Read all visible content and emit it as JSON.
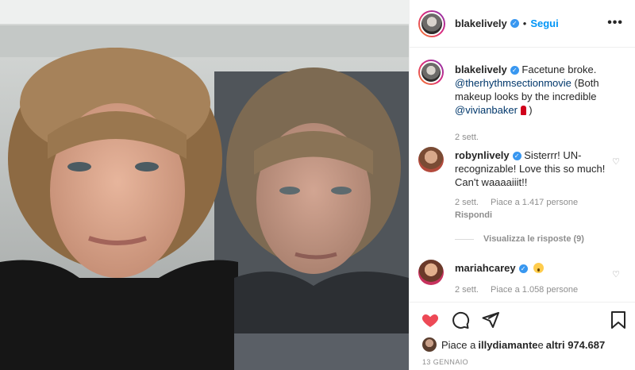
{
  "post": {
    "username": "blakelively",
    "follow_label": "Segui",
    "separator": "•",
    "more_label": "•••"
  },
  "caption": {
    "username": "blakelively",
    "text_1": "Facetune broke. ",
    "mention_1": "@therhythmsectionmovie",
    "text_2": " (Both makeup looks by the incredible ",
    "mention_2": "@vivianbaker",
    "text_3": " )",
    "time": "2 sett."
  },
  "comments": [
    {
      "username": "robynlively",
      "text": "Sisterrr! UN-recognizable! Love this so much! Can't waaaaiiit!!",
      "time": "2 sett.",
      "likes": "Piace a 1.417 persone",
      "reply_label": "Rispondi",
      "view_replies": "Visualizza le risposte (9)"
    },
    {
      "username": "mariahcarey",
      "text": "",
      "time": "2 sett.",
      "likes": "Piace a 1.058 persone"
    }
  ],
  "actions": {
    "liked_by_prefix": "Piace a ",
    "liked_by_user": "illydiamante",
    "liked_by_middle": " e ",
    "liked_by_others": "altri 974.687",
    "date": "13 GENNAIO"
  },
  "colors": {
    "accent": "#0095f6",
    "like_red": "#ed4956",
    "verified": "#3897f0",
    "muted": "#8e8e8e"
  },
  "icons": [
    "heart-filled-icon",
    "comment-icon",
    "share-icon",
    "bookmark-icon",
    "verified-icon",
    "more-icon",
    "heart-outline-icon"
  ]
}
